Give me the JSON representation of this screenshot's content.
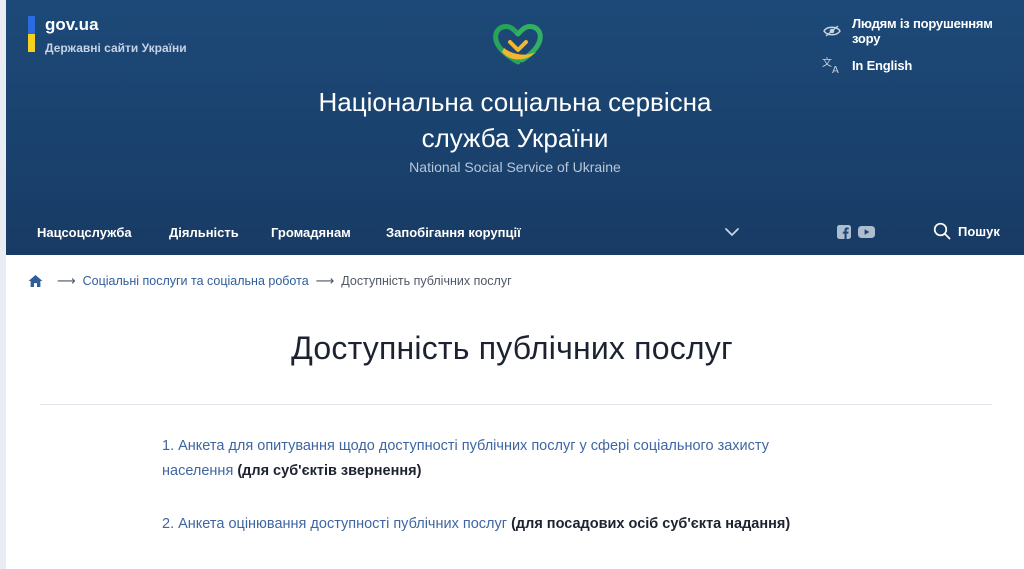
{
  "header": {
    "gov_title": "gov.ua",
    "gov_subtitle": "Державні сайти України",
    "title_line1": "Національна соціальна сервісна",
    "title_line2": "служба України",
    "subtitle": "National Social Service of Ukraine",
    "utility": {
      "accessibility_label": "Людям із порушенням зору",
      "language_label": "In English"
    }
  },
  "nav": {
    "items": [
      {
        "label": "Нацсоцслужба"
      },
      {
        "label": "Діяльність"
      },
      {
        "label": "Громадянам"
      },
      {
        "label": "Запобігання корупції"
      }
    ],
    "search_label": "Пошук"
  },
  "breadcrumb": {
    "link": "Соціальні послуги та соціальна робота",
    "current": "Доступність публічних послуг"
  },
  "page": {
    "title": "Доступність публічних послуг",
    "items": [
      {
        "link_line1": "1. Анкета для опитування щодо доступності публічних послуг у сфері соціального захисту",
        "link_line2": "населення",
        "note": "(для суб'єктів звернення)"
      },
      {
        "link_line1": "2. Анкета оцінювання доступності публічних послуг",
        "note": "(для посадових осіб суб'єкта надання)"
      }
    ]
  },
  "colors": {
    "header_bg": "#1c4676",
    "link": "#3f66a3",
    "flag_blue": "#2a6be0",
    "flag_yellow": "#f5d01c"
  },
  "icons": [
    "eye-icon",
    "translate-icon",
    "chevron-down-icon",
    "facebook-icon",
    "youtube-icon",
    "search-icon",
    "home-icon",
    "heart-logo-icon"
  ]
}
